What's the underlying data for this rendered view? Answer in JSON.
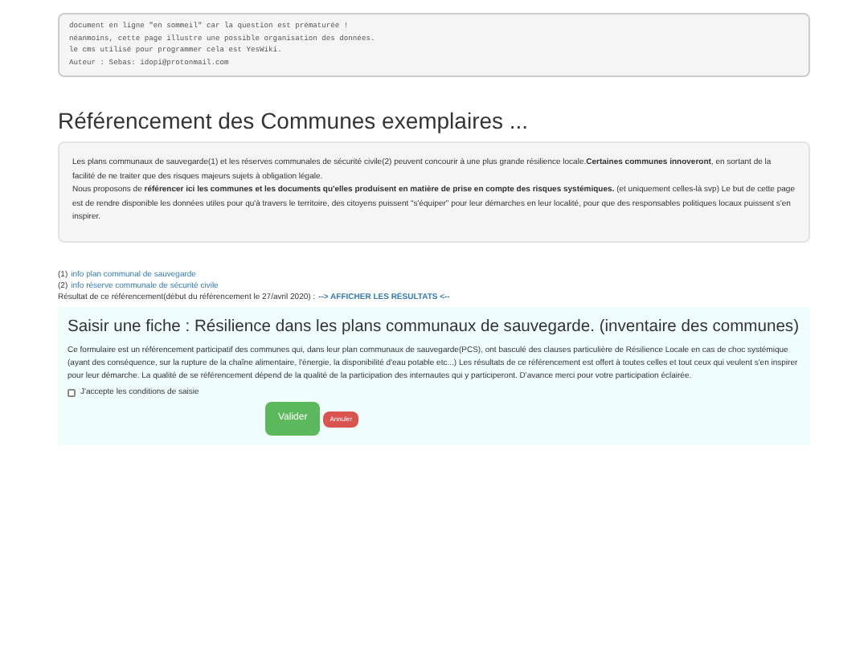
{
  "notice": {
    "lines": [
      "document en ligne \"en sommeil\" car la question est prématurée !",
      "néanmoins, cette page illustre une possible organisation des données.",
      "le cms utilisé pour programmer cela est YesWiki.",
      "Auteur : Sebas: idopi@protonmail.com"
    ]
  },
  "title": "Référencement des Communes exemplaires ...",
  "intro": [
    "Les plans communaux de sauvegarde(1) et les réserves communales de sécurité civile(2) peuvent concourir à une plus grande résilience locale.**Certaines communes innoveront**, en sortant de la facilité de ne traiter que des risques majeurs sujets à obligation légale.",
    "Nous proposons de **référencer ici les communes et les documents qu'elles produisent en matière de prise en compte des risques systémiques.** (et uniquement celles-là svp) Le but de cette page est de rendre disponible les données utiles pour qu'à travers le territoire, des citoyens puissent \"s'équiper\" pour leur démarches en leur localité, pour que des responsables politiques locaux puissent s'en inspirer."
  ],
  "references": [
    {
      "number": "(1)",
      "link": "info plan communal de sauvegarde"
    },
    {
      "number": "(2)",
      "link": "info réserve communale de sécurité civile"
    }
  ],
  "results": {
    "text": "Résultat de ce référencement(début du référencement le 27/avril 2020) :",
    "link": "--> AFFICHER LES RÉSULTATS <--"
  },
  "form": {
    "title": "Saisir une fiche :  Résilience dans les plans communaux de sauvegarde. (inventaire des communes)",
    "description": "Ce formulaire est un référencement participatif des communes qui, dans leur plan communaux de sauvegarde(PCS), ont basculé des clauses particulière de Résilience Locale en cas de choc systémique (ayant des conséquence, sur la rupture de la chaîne alimentaire, l'énergie, la disponibilité d'eau potable etc...) Les résultats de ce référencement est offert à toutes celles et tout ceux qui veulent s'en inspirer pour leur démarche. La qualité de se référencement dépend de la qualité de la participation des internautes qui y participeront. D'avance merci pour votre participation éclairée.",
    "consent": {
      "label": "J'accepte les conditions de saisie",
      "checked": false
    },
    "buttons": [
      {
        "label": "Valider",
        "kind": "primary"
      },
      {
        "label": "Annuler",
        "kind": "cancel"
      }
    ]
  }
}
